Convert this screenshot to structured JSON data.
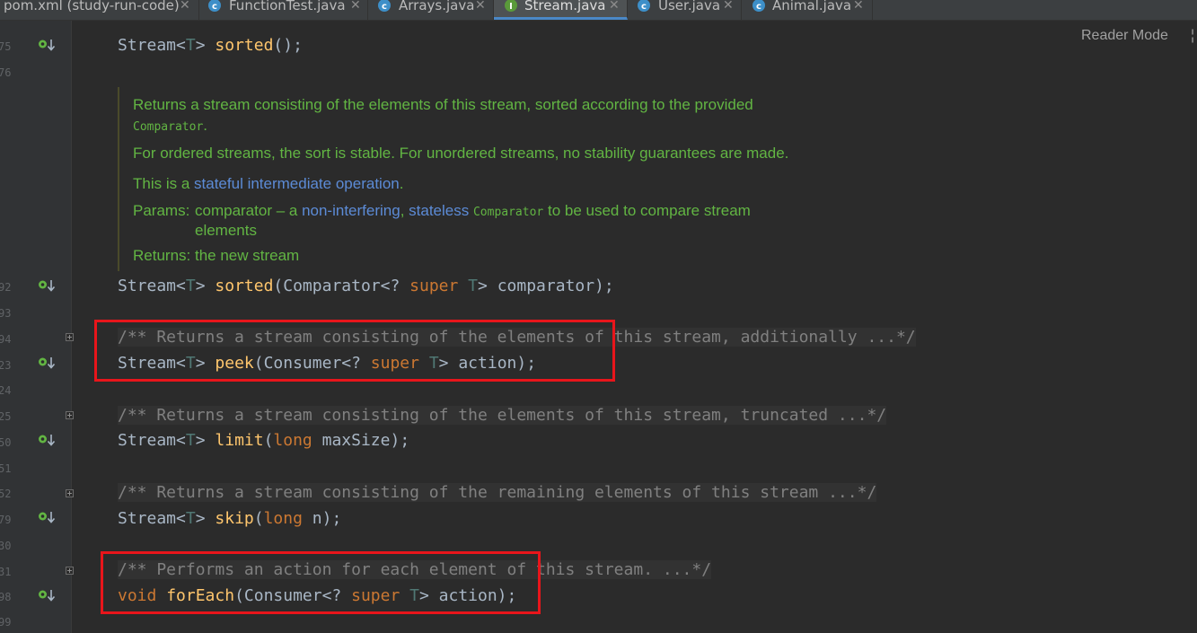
{
  "tabs": [
    {
      "label": "pom.xml (study-run-code)",
      "icon": "maven-icon",
      "active": false
    },
    {
      "label": "FunctionTest.java",
      "icon": "class-icon",
      "active": false
    },
    {
      "label": "Arrays.java",
      "icon": "class-icon",
      "active": false
    },
    {
      "label": "Stream.java",
      "icon": "interface-icon",
      "active": true
    },
    {
      "label": "User.java",
      "icon": "class-icon",
      "active": false
    },
    {
      "label": "Animal.java",
      "icon": "class-icon",
      "active": false
    }
  ],
  "tab_close": "✕",
  "reader_mode": "Reader Mode",
  "line_numbers": [
    "75",
    "76",
    "92",
    "93",
    "94",
    "23",
    "24",
    "25",
    "50",
    "51",
    "52",
    "79",
    "30",
    "31",
    "98",
    "99"
  ],
  "code": {
    "sorted_plain": {
      "type": "Stream<",
      "tp": "T",
      "type_close": "> ",
      "fn": "sorted",
      "rest": "();"
    },
    "sorted_cmp": {
      "type": "Stream<",
      "tp": "T",
      "type_close": "> ",
      "fn": "sorted",
      "mid": "(Comparator<? ",
      "kw": "super",
      "sp": " ",
      "tp2": "T",
      "rest": "> comparator);"
    },
    "peek_comment": "/** Returns a stream consisting of the elements of this stream, additionally ...*/",
    "peek": {
      "type": "Stream<",
      "tp": "T",
      "type_close": "> ",
      "fn": "peek",
      "mid": "(Consumer<? ",
      "kw": "super",
      "sp": " ",
      "tp2": "T",
      "rest": "> action);"
    },
    "limit_comment": "/** Returns a stream consisting of the elements of this stream, truncated ...*/",
    "limit": {
      "type": "Stream<",
      "tp": "T",
      "type_close": "> ",
      "fn": "limit",
      "mid": "(",
      "kw": "long",
      "rest": " maxSize);"
    },
    "skip_comment": "/** Returns a stream consisting of the remaining elements of this stream ...*/",
    "skip": {
      "type": "Stream<",
      "tp": "T",
      "type_close": "> ",
      "fn": "skip",
      "mid": "(",
      "kw": "long",
      "rest": " n);"
    },
    "foreach_comment": "/** Performs an action for each element of this stream. ...*/",
    "foreach": {
      "kw1": "void",
      "sp0": " ",
      "fn": "forEach",
      "mid": "(Consumer<? ",
      "kw": "super",
      "sp": " ",
      "tp2": "T",
      "rest": "> action);"
    }
  },
  "javadoc": {
    "line1": "Returns a stream consisting of the elements of this stream, sorted according to the provided",
    "line1_code": "Comparator",
    "line1_end": ".",
    "line2": "For ordered streams, the sort is stable. For unordered streams, no stability guarantees are made.",
    "line3_pre": "This is a ",
    "line3_link": "stateful intermediate operation",
    "line3_end": ".",
    "params_label": "Params:",
    "params_pre": "comparator – a ",
    "params_link1": "non-interfering",
    "params_sep": ", ",
    "params_link2": "stateless",
    "params_sp": " ",
    "params_code": "Comparator",
    "params_end": " to be used to compare stream",
    "params_cont": "elements",
    "returns_label": "Returns:",
    "returns_text": "the new stream"
  },
  "colors": {
    "highlight": "#e8151b",
    "keyword": "#cc7832",
    "method": "#ffc66d",
    "type_param": "#507874",
    "comment": "#808080",
    "doc_text": "#62b543",
    "doc_link": "#5c8bd6"
  }
}
